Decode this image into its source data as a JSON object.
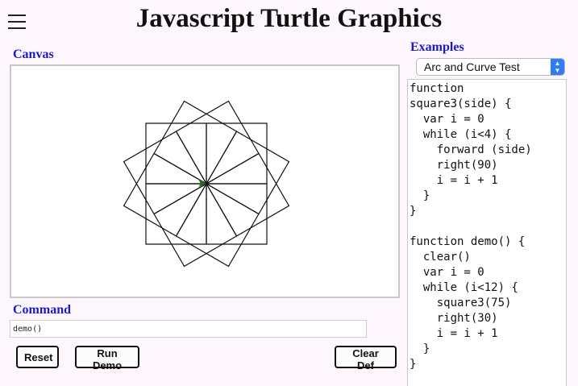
{
  "header": {
    "title": "Javascript Turtle Graphics",
    "menu_icon": "hamburger-menu-icon"
  },
  "canvas": {
    "label": "Canvas",
    "turtle_color": "#1a6e1a",
    "drawing": {
      "program": "demo()",
      "squares": 12,
      "square_side": 75,
      "turn_degrees": 30
    }
  },
  "command": {
    "label": "Command",
    "value": "demo()",
    "placeholder": ""
  },
  "buttons": {
    "reset": "Reset",
    "run_demo": "Run Demo",
    "clear_def": "Clear Def"
  },
  "examples": {
    "label": "Examples",
    "selected": "Arc and Curve Test",
    "code": "function\nsquare3(side) {\n  var i = 0\n  while (i<4) {\n    forward (side)\n    right(90)\n    i = i + 1\n  }\n}\n\nfunction demo() {\n  clear()\n  var i = 0\n  while (i<12) {\n    square3(75)\n    right(30)\n    i = i + 1\n  }\n}"
  },
  "colors": {
    "label_blue": "#1a1acc",
    "background": "#fdf6fd",
    "select_accent": "#2f7cf6"
  }
}
